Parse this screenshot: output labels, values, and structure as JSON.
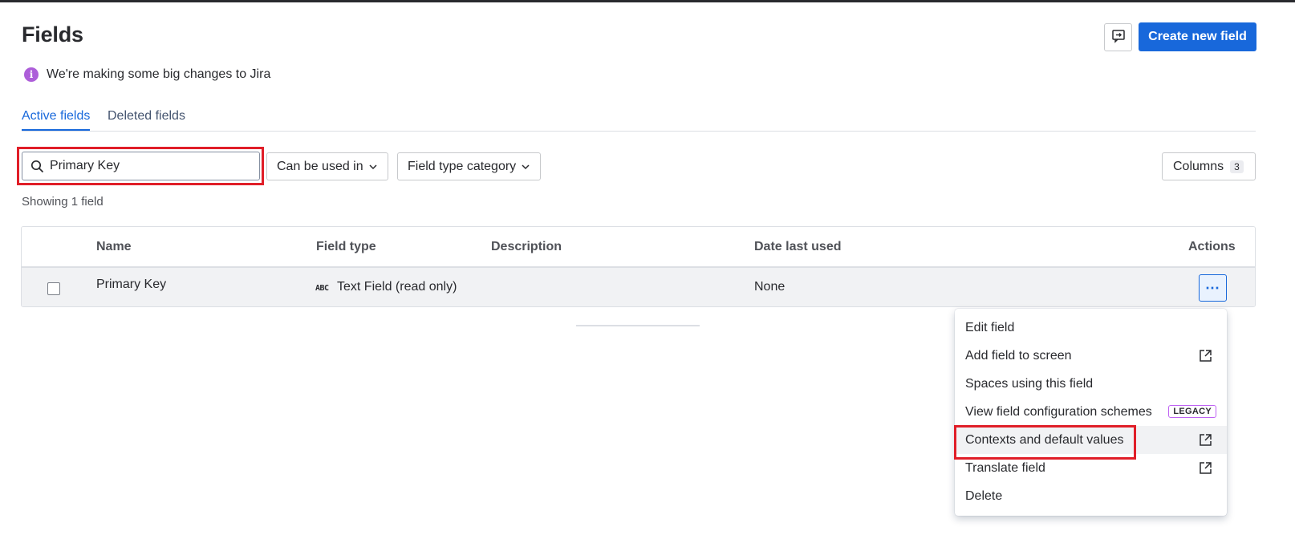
{
  "header": {
    "title": "Fields",
    "feedback_icon": "feedback-icon",
    "create_button": "Create new field"
  },
  "banner": {
    "icon": "info-icon",
    "icon_glyph": "i",
    "text": "We're making some big changes to Jira"
  },
  "tabs": [
    {
      "label": "Active fields",
      "active": true
    },
    {
      "label": "Deleted fields",
      "active": false
    }
  ],
  "filters": {
    "search_value": "Primary Key",
    "can_be_used_in": "Can be used in",
    "field_type_category": "Field type category",
    "columns_label": "Columns",
    "columns_count": "3"
  },
  "showing": "Showing 1 field",
  "table": {
    "headers": {
      "name": "Name",
      "field_type": "Field type",
      "description": "Description",
      "date_last_used": "Date last used",
      "actions": "Actions"
    },
    "rows": [
      {
        "name": "Primary Key",
        "field_type_icon": "ABC",
        "field_type": "Text Field (read only)",
        "description": "",
        "date_last_used": "None",
        "actions_glyph": "⋯"
      }
    ]
  },
  "actions_menu": {
    "items": [
      {
        "label": "Edit field",
        "external": false
      },
      {
        "label": "Add field to screen",
        "external": true
      },
      {
        "label": "Spaces using this field",
        "external": false
      },
      {
        "label": "View field configuration schemes",
        "external": false,
        "badge": "LEGACY"
      },
      {
        "label": "Contexts and default values",
        "external": true,
        "highlighted": true
      },
      {
        "label": "Translate field",
        "external": true
      },
      {
        "label": "Delete",
        "external": false
      }
    ]
  },
  "colors": {
    "primary": "#1868db",
    "highlight": "#e01e28",
    "info": "#ad5ed9",
    "legacy_border": "#bf63f3"
  }
}
